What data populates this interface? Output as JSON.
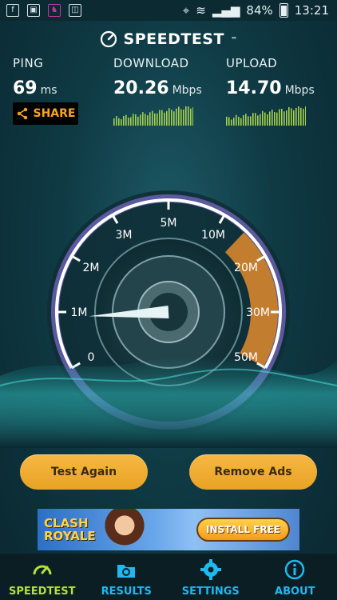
{
  "status_bar": {
    "battery": "84%",
    "time": "13:21"
  },
  "app": {
    "title": "SPEEDTEST"
  },
  "stats": {
    "ping": {
      "label": "PING",
      "value": "69",
      "unit": "ms"
    },
    "download": {
      "label": "DOWNLOAD",
      "value": "20.26",
      "unit": "Mbps"
    },
    "upload": {
      "label": "UPLOAD",
      "value": "14.70",
      "unit": "Mbps"
    }
  },
  "share_label": "SHARE",
  "gauge": {
    "ticks": [
      "0",
      "1M",
      "2M",
      "3M",
      "5M",
      "10M",
      "20M",
      "30M",
      "50M"
    ],
    "needle_value": "0.9"
  },
  "buttons": {
    "test_again": "Test Again",
    "remove_ads": "Remove Ads"
  },
  "ad": {
    "brand_line1": "CLASH",
    "brand_line2": "ROYALE",
    "cta": "INSTALL FREE"
  },
  "nav": [
    {
      "label": "SPEEDTEST",
      "icon": "gauge-icon"
    },
    {
      "label": "RESULTS",
      "icon": "folder-icon"
    },
    {
      "label": "SETTINGS",
      "icon": "gear-icon"
    },
    {
      "label": "ABOUT",
      "icon": "info-icon"
    }
  ],
  "colors": {
    "accent_green": "#b4e13c",
    "accent_blue": "#1fb9f0",
    "button": "#f2ad33",
    "progress": "#e38b2d"
  }
}
